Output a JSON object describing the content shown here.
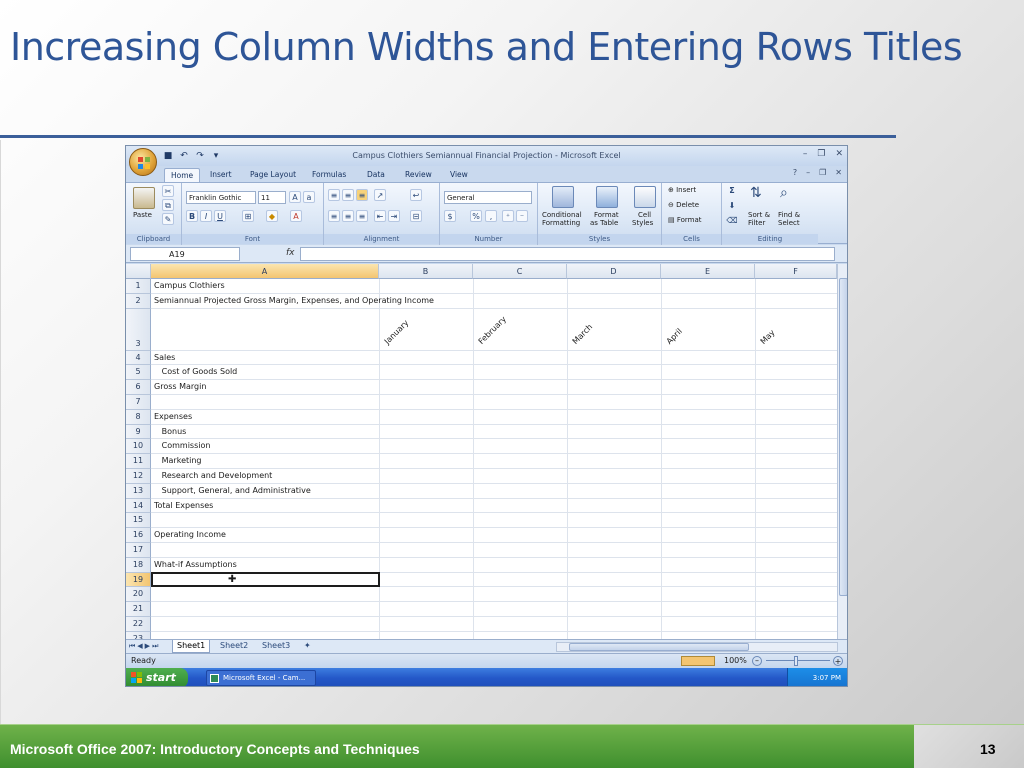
{
  "slide": {
    "title": "Increasing Column Widths and Entering Rows Titles",
    "footer_text": "Microsoft Office 2007: Introductory Concepts and Techniques",
    "page_number": "13"
  },
  "excel": {
    "window_title": "Campus Clothiers Semiannual Financial Projection - Microsoft Excel",
    "tabs": [
      "Home",
      "Insert",
      "Page Layout",
      "Formulas",
      "Data",
      "Review",
      "View"
    ],
    "active_tab": "Home",
    "ribbon": {
      "clipboard": {
        "label": "Clipboard",
        "paste": "Paste"
      },
      "font": {
        "label": "Font",
        "name": "Franklin Gothic",
        "size": "11",
        "bold": "B",
        "italic": "I",
        "underline": "U"
      },
      "alignment": {
        "label": "Alignment"
      },
      "number": {
        "label": "Number",
        "format": "General",
        "currency": "$",
        "percent": "%",
        "comma": ","
      },
      "styles": {
        "label": "Styles",
        "conditional": "Conditional",
        "conditional2": "Formatting",
        "format": "Format",
        "format2": "as Table",
        "cell": "Cell",
        "cell2": "Styles"
      },
      "cells": {
        "label": "Cells",
        "insert": "Insert",
        "delete": "Delete",
        "format": "Format"
      },
      "editing": {
        "label": "Editing",
        "sort": "Sort &",
        "sort2": "Filter",
        "find": "Find &",
        "find2": "Select"
      }
    },
    "name_box": "A19",
    "fx": "fx",
    "columns": [
      "A",
      "B",
      "C",
      "D",
      "E",
      "F"
    ],
    "rows": [
      {
        "num": "1",
        "a": "Campus Clothiers"
      },
      {
        "num": "2",
        "a": "Semiannual Projected Gross Margin, Expenses, and Operating Income"
      },
      {
        "num": "3",
        "a": ""
      },
      {
        "num": "4",
        "a": "Sales"
      },
      {
        "num": "5",
        "a": "   Cost of Goods Sold"
      },
      {
        "num": "6",
        "a": "Gross Margin"
      },
      {
        "num": "7",
        "a": ""
      },
      {
        "num": "8",
        "a": "Expenses"
      },
      {
        "num": "9",
        "a": "   Bonus"
      },
      {
        "num": "10",
        "a": "   Commission"
      },
      {
        "num": "11",
        "a": "   Marketing"
      },
      {
        "num": "12",
        "a": "   Research and Development"
      },
      {
        "num": "13",
        "a": "   Support, General, and Administrative"
      },
      {
        "num": "14",
        "a": "Total Expenses"
      },
      {
        "num": "15",
        "a": ""
      },
      {
        "num": "16",
        "a": "Operating Income"
      },
      {
        "num": "17",
        "a": ""
      },
      {
        "num": "18",
        "a": "What-if Assumptions"
      },
      {
        "num": "19",
        "a": ""
      },
      {
        "num": "20",
        "a": ""
      },
      {
        "num": "21",
        "a": ""
      },
      {
        "num": "22",
        "a": ""
      },
      {
        "num": "23",
        "a": ""
      }
    ],
    "months": [
      "January",
      "February",
      "March",
      "April",
      "May"
    ],
    "sheets": [
      "Sheet1",
      "Sheet2",
      "Sheet3"
    ],
    "active_sheet": "Sheet1",
    "status": "Ready",
    "zoom": "100%",
    "taskbar": {
      "start": "start",
      "item": "Microsoft Excel - Cam...",
      "time": "3:07 PM"
    }
  }
}
